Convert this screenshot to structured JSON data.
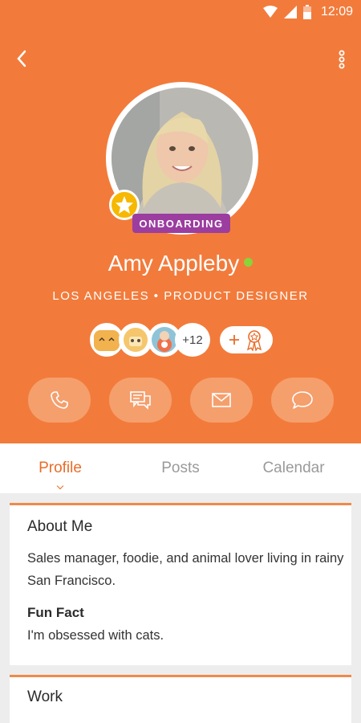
{
  "status": {
    "time": "12:09"
  },
  "profile": {
    "badge": "ONBOARDING",
    "name": "Amy Appleby",
    "subtitle": "LOS ANGELES • PRODUCT DESIGNER",
    "team_more": "+12",
    "status_color": "#8ad33a"
  },
  "actions": [
    "phone-icon",
    "messages-icon",
    "mail-icon",
    "chat-icon"
  ],
  "tabs": {
    "profile": "Profile",
    "posts": "Posts",
    "calendar": "Calendar"
  },
  "about": {
    "title": "About Me",
    "text": "Sales manager, foodie, and animal lover living in rainy San Francisco.",
    "fun_title": "Fun Fact",
    "fun_text": "I'm obsessed with cats."
  },
  "work": {
    "title": "Work"
  },
  "colors": {
    "accent": "#f27b3b",
    "badge": "#9b3ea0",
    "star": "#f6b800"
  }
}
